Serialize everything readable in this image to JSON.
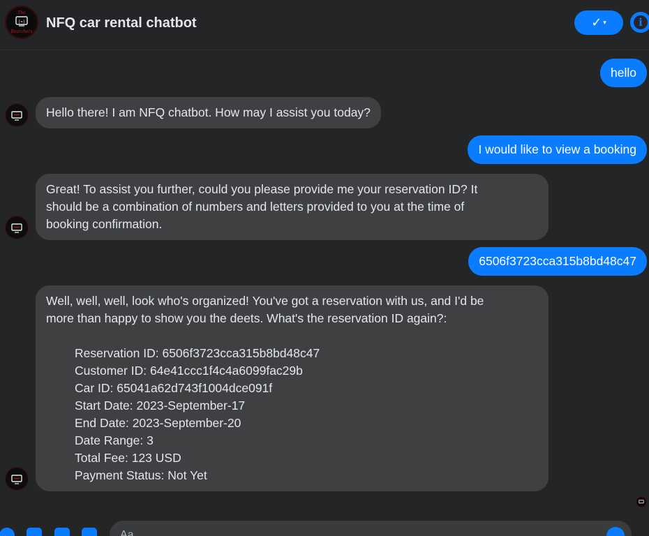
{
  "header": {
    "title": "NFQ car rental chatbot",
    "verify_icon": "✓",
    "caret_icon": "▾",
    "info_icon": "i"
  },
  "avatar": {
    "top_text": "The",
    "bottom_text": "Bearchers",
    "middle_text": "[=]"
  },
  "messages": [
    {
      "from": "user",
      "text": "hello"
    },
    {
      "from": "bot",
      "text": "Hello there! I am NFQ chatbot. How may I assist you today?"
    },
    {
      "from": "user",
      "text": "I would like to view a booking"
    },
    {
      "from": "bot",
      "lines": [
        "Great! To assist you further, could you please provide me your reservation ID? It",
        "should be a combination of numbers and letters provided to you at the time of",
        "booking confirmation."
      ]
    },
    {
      "from": "user",
      "text": "6506f3723cca315b8bd48c47"
    },
    {
      "from": "bot",
      "lines": [
        "Well, well, well, look who's organized! You've got a reservation with us, and I'd be",
        "more than happy to show you the deets. What's the reservation ID again?:"
      ],
      "details": [
        "Reservation ID: 6506f3723cca315b8bd48c47",
        "Customer ID: 64e41ccc1f4c4a6099fac29b",
        "Car ID: 65041a62d743f1004dce091f",
        "Start Date: 2023-September-17",
        "End Date: 2023-September-20",
        "Date Range: 3",
        "Total Fee: 123 USD",
        "Payment Status: Not Yet"
      ]
    }
  ],
  "composer": {
    "placeholder": "Aa"
  },
  "colors": {
    "accent": "#0a7cff",
    "background": "#242526",
    "incoming_bubble": "#3e4042"
  }
}
